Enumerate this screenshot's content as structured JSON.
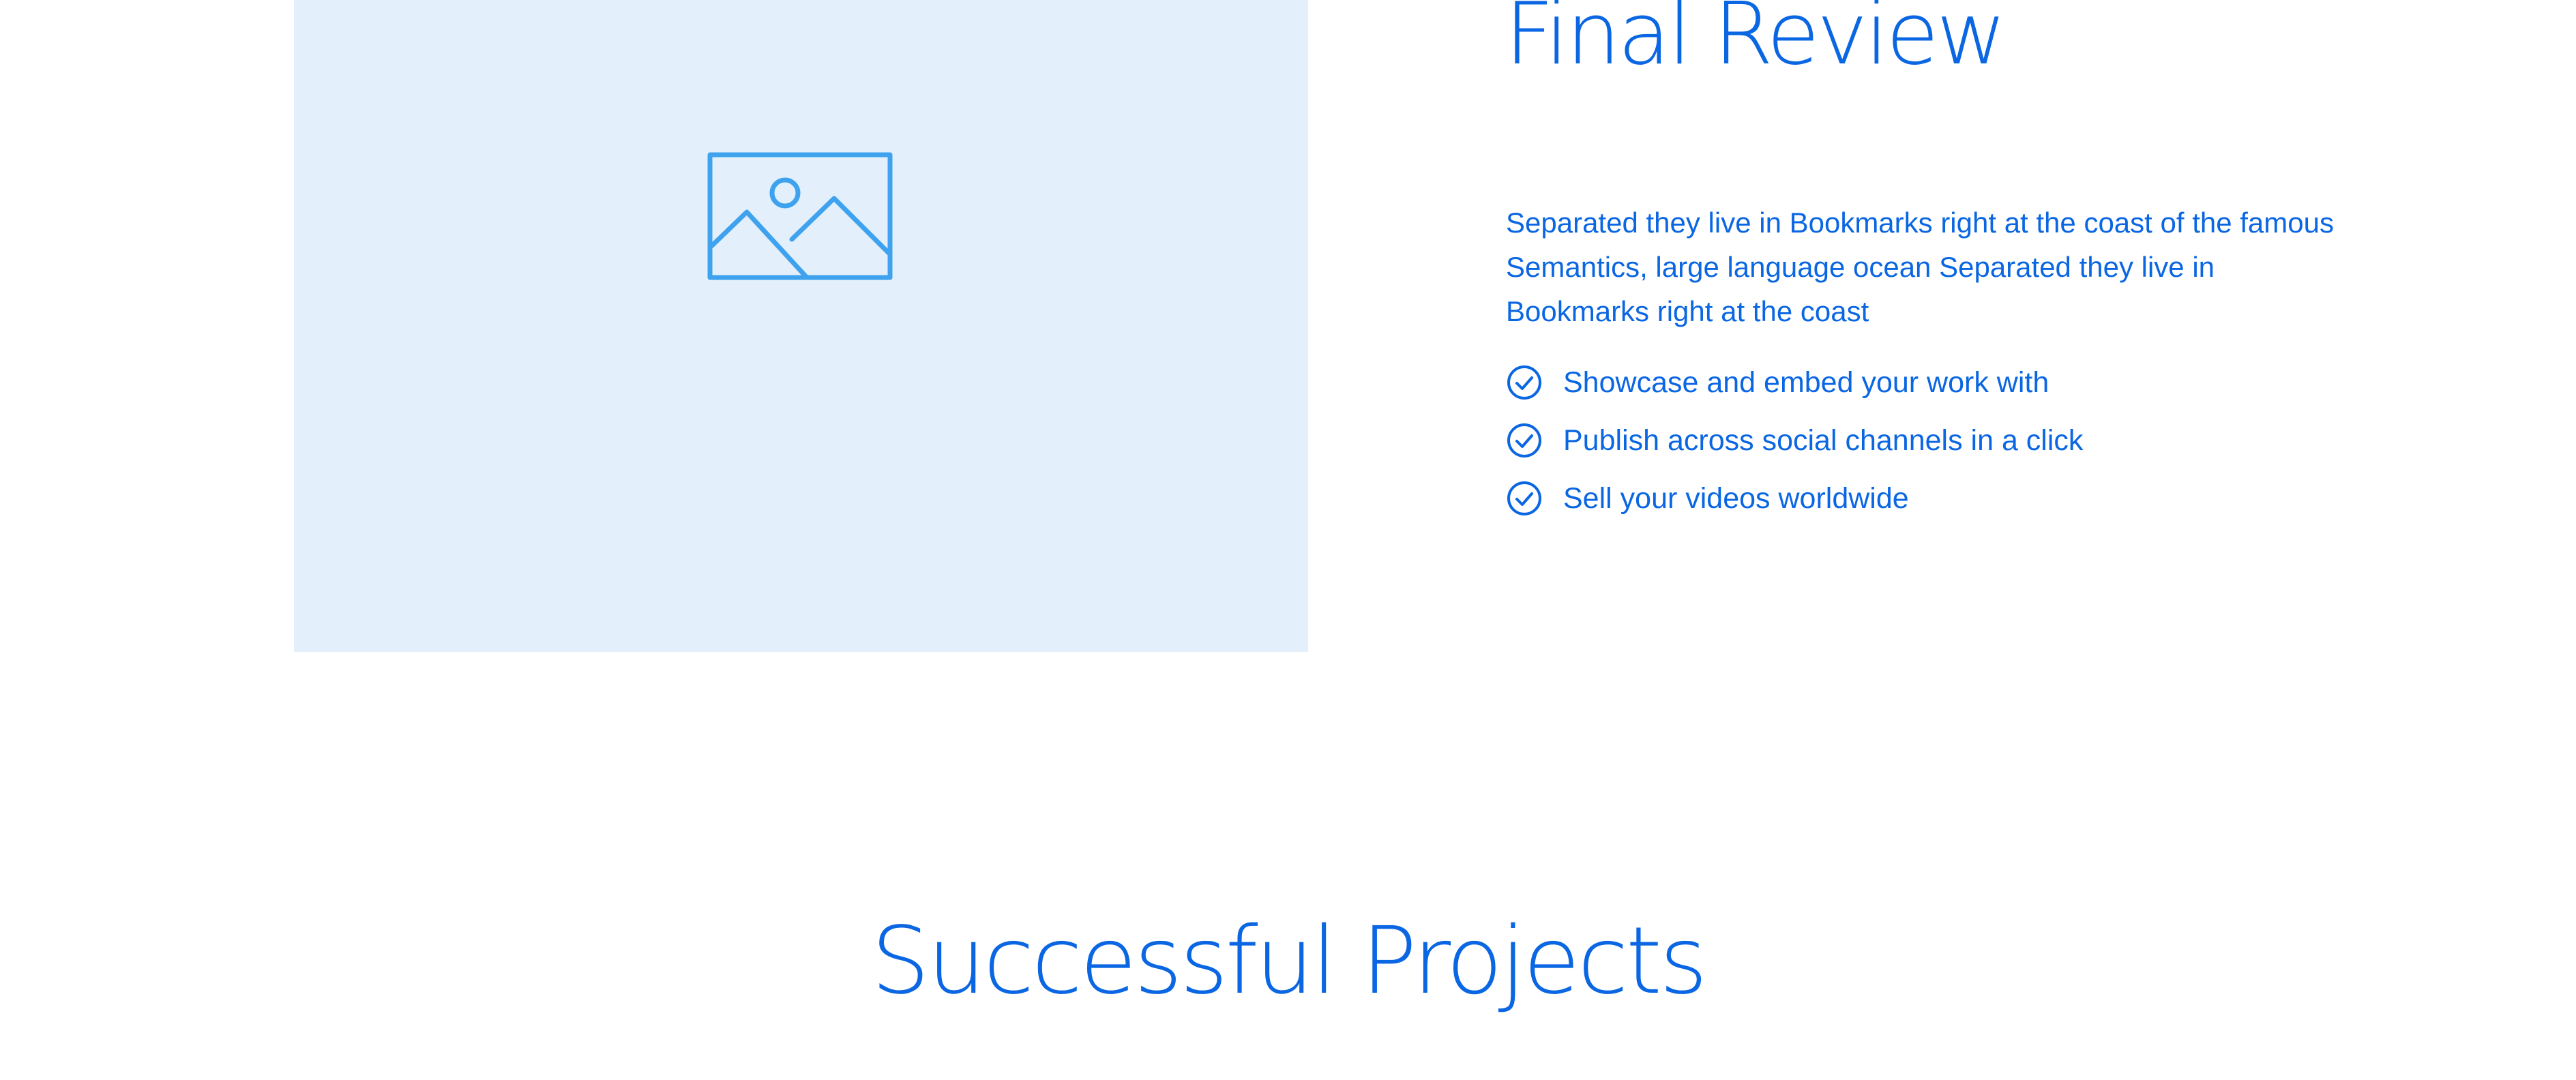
{
  "feature": {
    "title_visible_line": "Final Review",
    "description": "Separated they live in Bookmarks right at the coast of the famous Semantics, large language ocean Separated they live in Bookmarks right at the coast",
    "items": [
      {
        "label": "Showcase and embed your work with",
        "icon": "check-circle-icon"
      },
      {
        "label": "Publish across social channels in a click",
        "icon": "check-circle-icon"
      },
      {
        "label": "Sell your videos worldwide",
        "icon": "check-circle-icon"
      }
    ],
    "image_icon": "image-placeholder-icon"
  },
  "projects": {
    "title": "Successful Projects"
  },
  "colors": {
    "accent": "#0a66e2",
    "placeholder_bg": "#e3f0fc",
    "placeholder_icon": "#3fa2ee"
  }
}
